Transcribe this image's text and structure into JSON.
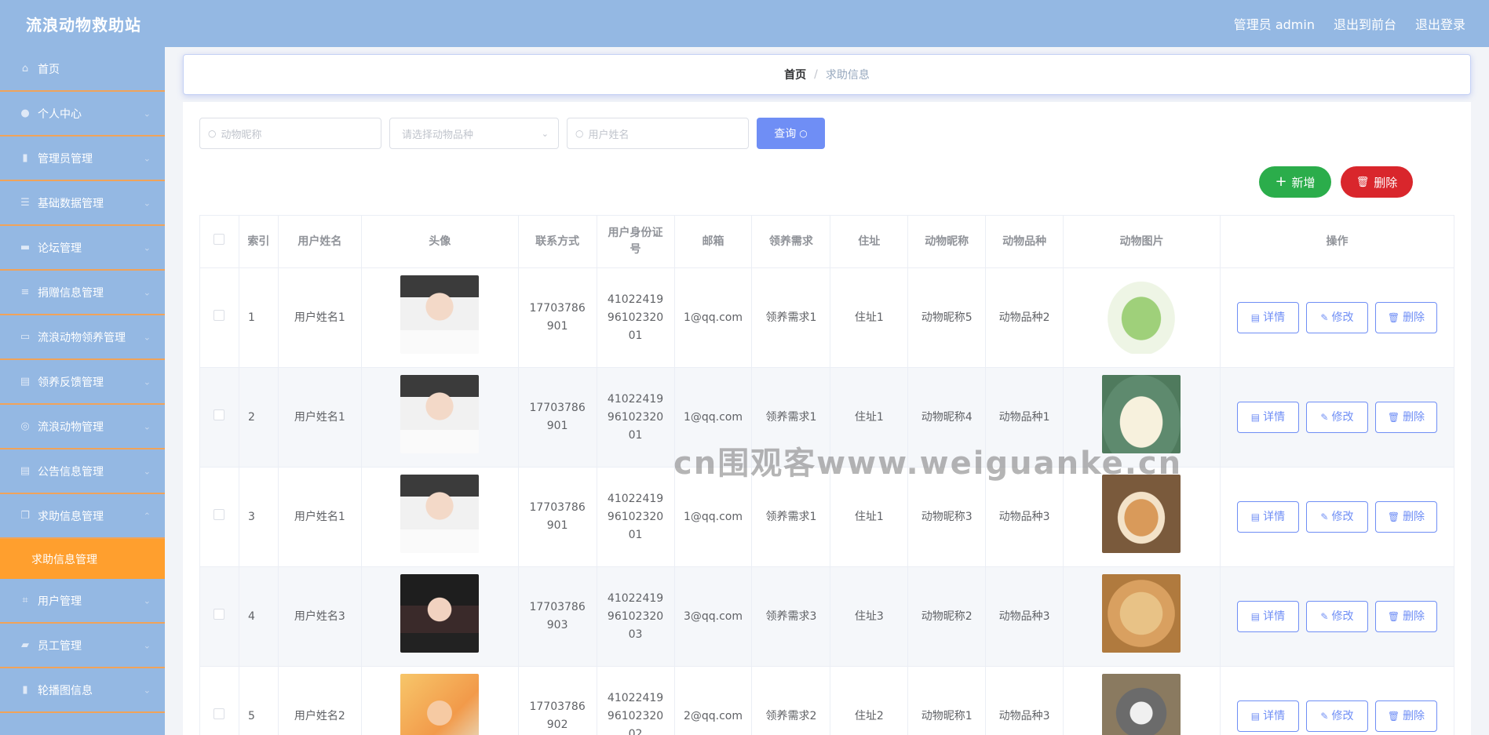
{
  "app": {
    "title": "流浪动物救助站"
  },
  "header": {
    "admin_label": "管理员 admin",
    "front_label": "退出到前台",
    "logout_label": "退出登录"
  },
  "sidebar": {
    "items": [
      {
        "label": "首页",
        "icon": "home-icon",
        "glyph": "⌂",
        "has_arrow": false
      },
      {
        "label": "个人中心",
        "icon": "user-icon",
        "glyph": "●",
        "has_arrow": true
      },
      {
        "label": "管理员管理",
        "icon": "bar-chart-icon",
        "glyph": "▮",
        "has_arrow": true
      },
      {
        "label": "基础数据管理",
        "icon": "list-icon",
        "glyph": "☰",
        "has_arrow": true
      },
      {
        "label": "论坛管理",
        "icon": "briefcase-icon",
        "glyph": "▬",
        "has_arrow": true
      },
      {
        "label": "捐赠信息管理",
        "icon": "sliders-icon",
        "glyph": "≡",
        "has_arrow": true
      },
      {
        "label": "流浪动物领养管理",
        "icon": "card-icon",
        "glyph": "▭",
        "has_arrow": true
      },
      {
        "label": "领养反馈管理",
        "icon": "clipboard-icon",
        "glyph": "▤",
        "has_arrow": true
      },
      {
        "label": "流浪动物管理",
        "icon": "target-icon",
        "glyph": "◎",
        "has_arrow": true
      },
      {
        "label": "公告信息管理",
        "icon": "clipboard-icon",
        "glyph": "▤",
        "has_arrow": true
      },
      {
        "label": "求助信息管理",
        "icon": "copy-icon",
        "glyph": "❐",
        "has_arrow": true,
        "expanded": true
      },
      {
        "label": "用户管理",
        "icon": "crop-icon",
        "glyph": "⌗",
        "has_arrow": true
      },
      {
        "label": "员工管理",
        "icon": "chat-icon",
        "glyph": "▰",
        "has_arrow": true
      },
      {
        "label": "轮播图信息",
        "icon": "bar-chart-icon",
        "glyph": "▮",
        "has_arrow": true
      }
    ],
    "sub_active": "求助信息管理"
  },
  "breadcrumb": {
    "home": "首页",
    "sep": "/",
    "current": "求助信息"
  },
  "search": {
    "pet_name_placeholder": "动物昵称",
    "breed_placeholder": "请选择动物品种",
    "user_name_placeholder": "用户姓名",
    "query_label": "查询"
  },
  "actions": {
    "add_label": "新增",
    "delete_label": "删除"
  },
  "table": {
    "headers": [
      "索引",
      "用户姓名",
      "头像",
      "联系方式",
      "用户身份证号",
      "邮箱",
      "领养需求",
      "住址",
      "动物昵称",
      "动物品种",
      "动物图片",
      "操作"
    ],
    "rows": [
      {
        "index": "1",
        "name": "用户姓名1",
        "phone": "17703786901",
        "id_card": "410224199610232001",
        "email": "1@qq.com",
        "demand": "领养需求1",
        "address": "住址1",
        "pet_name": "动物昵称5",
        "breed": "动物品种2"
      },
      {
        "index": "2",
        "name": "用户姓名1",
        "phone": "17703786901",
        "id_card": "410224199610232001",
        "email": "1@qq.com",
        "demand": "领养需求1",
        "address": "住址1",
        "pet_name": "动物昵称4",
        "breed": "动物品种1"
      },
      {
        "index": "3",
        "name": "用户姓名1",
        "phone": "17703786901",
        "id_card": "410224199610232001",
        "email": "1@qq.com",
        "demand": "领养需求1",
        "address": "住址1",
        "pet_name": "动物昵称3",
        "breed": "动物品种3"
      },
      {
        "index": "4",
        "name": "用户姓名3",
        "phone": "17703786903",
        "id_card": "410224199610232003",
        "email": "3@qq.com",
        "demand": "领养需求3",
        "address": "住址3",
        "pet_name": "动物昵称2",
        "breed": "动物品种3"
      },
      {
        "index": "5",
        "name": "用户姓名2",
        "phone": "17703786902",
        "id_card": "410224199610232002",
        "email": "2@qq.com",
        "demand": "领养需求2",
        "address": "住址2",
        "pet_name": "动物昵称1",
        "breed": "动物品种3"
      }
    ],
    "op_labels": {
      "detail": "详情",
      "edit": "修改",
      "delete": "删除"
    }
  },
  "watermark": "cn围观客www.weiguanke.cn",
  "colors": {
    "sidebar": "#94b8e3",
    "active_sub": "#ff9f2e",
    "primary": "#6f8ef5",
    "success": "#2bad4b",
    "danger": "#d9262c"
  }
}
